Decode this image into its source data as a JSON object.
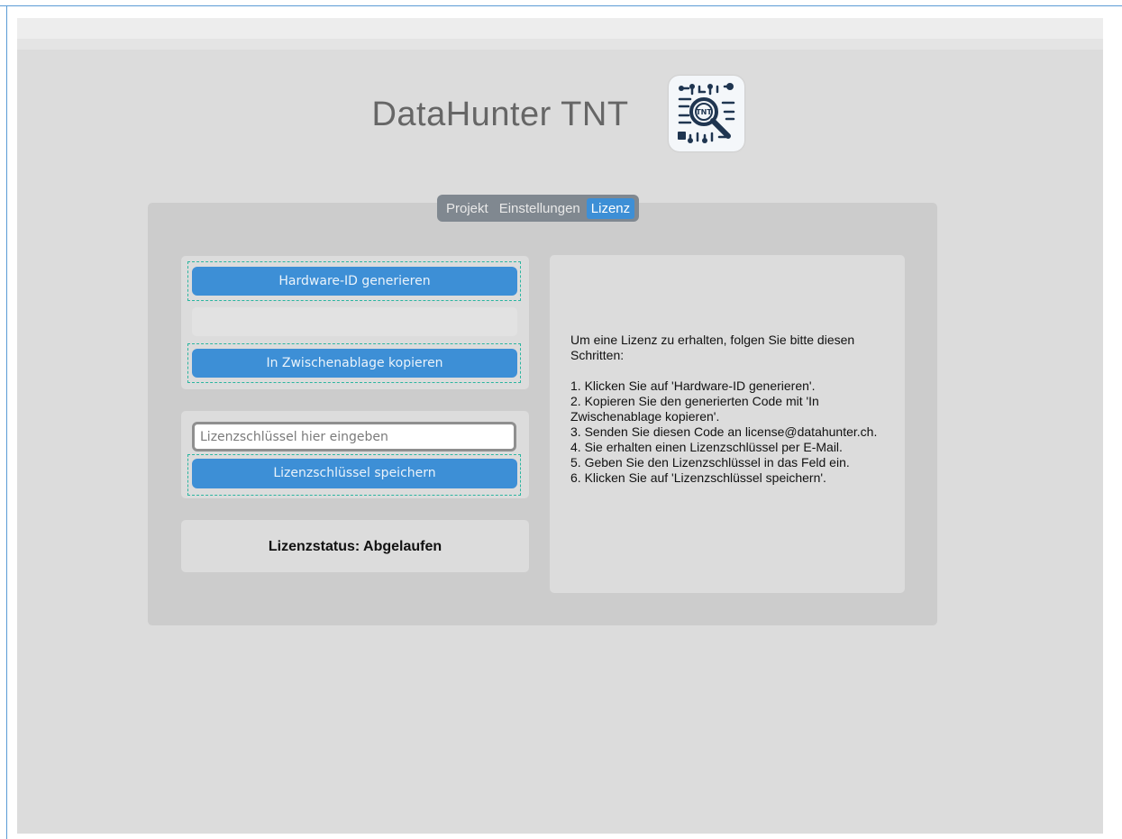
{
  "app": {
    "title": "DataHunter TNT",
    "logo_text": "TNT",
    "logo_icon": "magnifier-circuit-logo"
  },
  "tabs": [
    {
      "label": "Projekt",
      "active": false
    },
    {
      "label": "Einstellungen",
      "active": false
    },
    {
      "label": "Lizenz",
      "active": true
    }
  ],
  "hardware": {
    "generate_label": "Hardware-ID generieren",
    "hardware_id_value": "",
    "copy_label": "In Zwischenablage kopieren"
  },
  "license": {
    "key_placeholder": "Lizenzschlüssel hier eingeben",
    "key_value": "",
    "save_label": "Lizenzschlüssel speichern",
    "status_text": "Lizenzstatus: Abgelaufen"
  },
  "instructions": {
    "intro": "Um eine Lizenz zu erhalten, folgen Sie bitte diesen Schritten:",
    "steps": [
      "1. Klicken Sie auf 'Hardware-ID generieren'.",
      "2. Kopieren Sie den generierten Code mit 'In Zwischenablage kopieren'.",
      "3. Senden Sie diesen Code an license@datahunter.ch.",
      "4. Sie erhalten einen Lizenzschlüssel per E-Mail.",
      "5. Geben Sie den Lizenzschlüssel in das Feld ein.",
      "6. Klicken Sie auf 'Lizenzschlüssel speichern'."
    ]
  },
  "colors": {
    "accent": "#3d8fd6",
    "focus_outline": "#2bb5a0",
    "background": "#dcdcdc",
    "panel": "#cccccc"
  }
}
